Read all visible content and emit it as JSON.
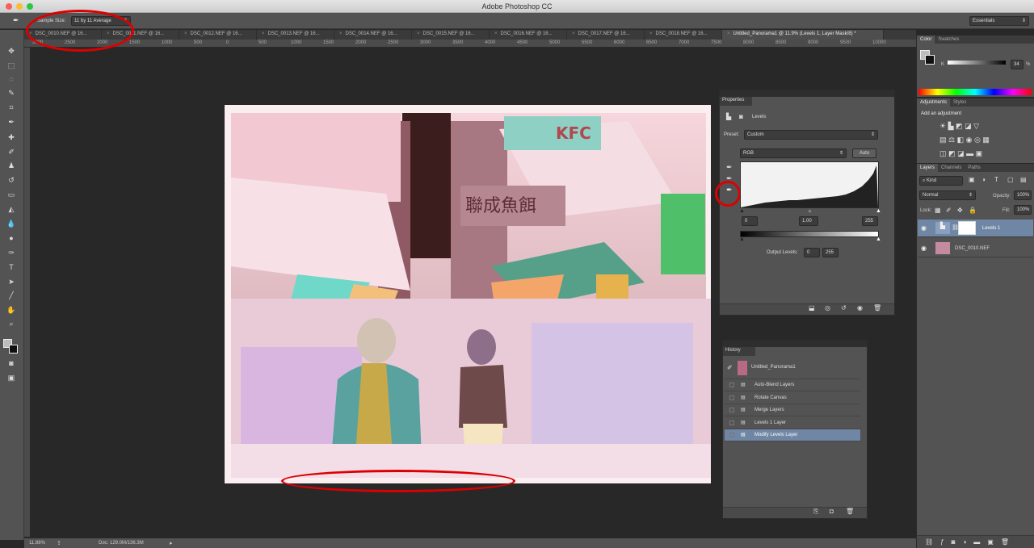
{
  "app": {
    "title": "Adobe Photoshop CC"
  },
  "options_bar": {
    "sample_size_label": "Sample Size:",
    "sample_size_value": "11 by 11 Average",
    "workspace": "Essentials"
  },
  "tabs": [
    "DSC_0010.NEF @ 16...",
    "DSC_0011.NEF @ 16...",
    "DSC_0012.NEF @ 16...",
    "DSC_0013.NEF @ 16...",
    "DSC_0014.NEF @ 16...",
    "DSC_0015.NEF @ 16...",
    "DSC_0016.NEF @ 16...",
    "DSC_0017.NEF @ 16...",
    "DSC_0018.NEF @ 16...",
    "Untitled_Panorama1 @ 11.9% (Levels 1, Layer Mask/8) *"
  ],
  "ruler_labels": [
    "3000",
    "2500",
    "2000",
    "1500",
    "1000",
    "500",
    "0",
    "500",
    "1000",
    "1500",
    "2000",
    "2500",
    "3000",
    "3500",
    "4000",
    "4500",
    "5000",
    "5500",
    "6000",
    "6500",
    "7000",
    "7500",
    "8000",
    "8500",
    "9000",
    "9500",
    "10000"
  ],
  "status": {
    "zoom": "11.88%",
    "doc": "Doc: 129.0M/136.3M"
  },
  "properties": {
    "panel_title": "Properties",
    "adjustment_name": "Levels",
    "preset_label": "Preset:",
    "preset_value": "Custom",
    "channel": "RGB",
    "auto_label": "Auto",
    "input_black": "0",
    "input_gamma": "1.00",
    "input_white": "255",
    "output_label": "Output Levels:",
    "output_black": "0",
    "output_white": "255"
  },
  "history": {
    "panel_title": "History",
    "snapshot": "Untitled_Panorama1",
    "items": [
      "Auto-Blend Layers",
      "Rotate Canvas",
      "Merge Layers",
      "Levels 1 Layer",
      "Modify Levels Layer"
    ]
  },
  "color_panel": {
    "tabs": [
      "Color",
      "Swatches"
    ],
    "k_label": "K",
    "k_value": "34",
    "percent": "%"
  },
  "adjustments_panel": {
    "tabs": [
      "Adjustments",
      "Styles"
    ],
    "heading": "Add an adjustment"
  },
  "layers_panel": {
    "tabs": [
      "Layers",
      "Channels",
      "Paths"
    ],
    "kind": "Kind",
    "blend_mode": "Normal",
    "opacity_label": "Opacity:",
    "opacity_value": "100%",
    "lock_label": "Lock:",
    "fill_label": "Fill:",
    "fill_value": "100%",
    "layers": [
      "Levels 1",
      "DSC_0010.NEF"
    ]
  },
  "photo_sign": {
    "brand": "KFC",
    "chinese": "聯成魚餌"
  },
  "colors": {
    "accent_red": "#dd0000",
    "selection_blue": "#6f86a5",
    "panel_gray": "#535353"
  }
}
